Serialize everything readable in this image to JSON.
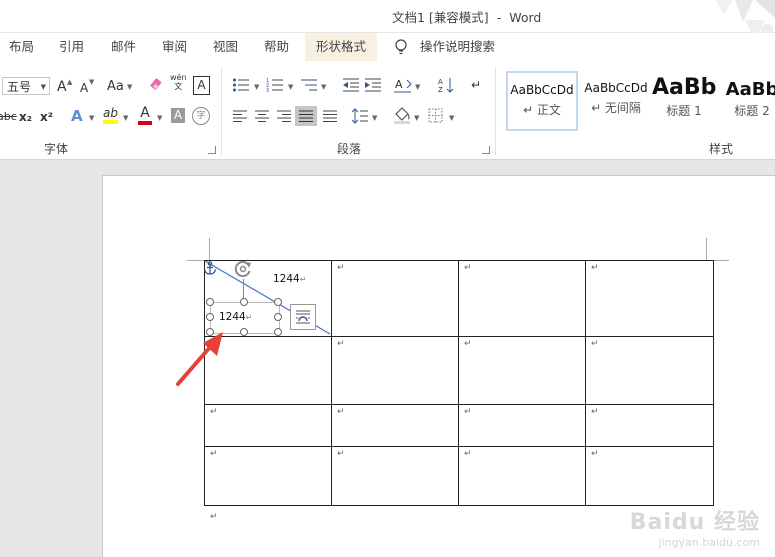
{
  "window": {
    "document_name": "文档1 [兼容模式]",
    "separator": "-",
    "app_name": "Word"
  },
  "tabs": [
    {
      "label": "布局"
    },
    {
      "label": "引用"
    },
    {
      "label": "邮件"
    },
    {
      "label": "审阅"
    },
    {
      "label": "视图"
    },
    {
      "label": "帮助"
    },
    {
      "label": "形状格式",
      "contextual": true
    },
    {
      "label": "操作说明搜索"
    }
  ],
  "ribbon": {
    "font_group": {
      "label": "字体",
      "font_size": "五号",
      "grow_font": "A",
      "shrink_font": "A",
      "change_case": "Aa",
      "clear_format_icon": "eraser-icon",
      "phonetic_top": "wén",
      "phonetic_bottom": "文",
      "char_border": "A",
      "strikethrough": "abc",
      "subscript": "x₂",
      "superscript": "x²",
      "text_effects": "A",
      "highlight": "ab",
      "font_color": "A",
      "char_shading": "A",
      "enclosed_char": "字"
    },
    "paragraph_group": {
      "label": "段落"
    },
    "styles_group": {
      "label": "样式",
      "tiles": [
        {
          "sample": "AaBbCcDd",
          "name": "↵ 正文",
          "active": true
        },
        {
          "sample": "AaBbCcDd",
          "name": "↵ 无间隔"
        },
        {
          "sample": "AaBb",
          "name": "标题 1"
        },
        {
          "sample": "AaBb",
          "name": "标题 2"
        }
      ]
    }
  },
  "document": {
    "textbox_top_text": "1244",
    "textbox_bottom_text": "1244",
    "cell_mark": "↵",
    "return_mark": "↵"
  },
  "watermark": {
    "brand": "Baidu 经验",
    "url": "jingyan.baidu.com"
  },
  "colors": {
    "accent_blue": "#2b579a",
    "arrow_red": "#e8413a",
    "highlight_yellow": "#ffff00",
    "font_red": "#d0021b"
  }
}
